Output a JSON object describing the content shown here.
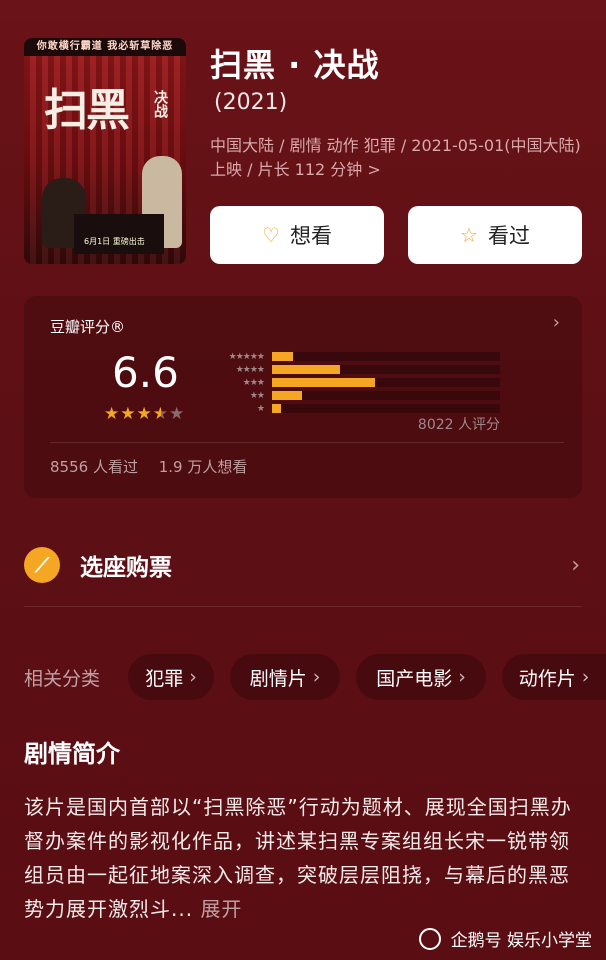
{
  "poster": {
    "top_strip": "你敢横行霸道 我必斩草除恶",
    "big_title": "扫黑",
    "small_title": "决战",
    "date_text": "6月1日 重磅出击"
  },
  "movie": {
    "title": "扫黑 · 决战",
    "year": "(2021)",
    "meta": "中国大陆 / 剧情 动作 犯罪 / 2021-05-01(中国大陆) 上映 / 片长 112 分钟 >"
  },
  "buttons": {
    "want": "想看",
    "seen": "看过"
  },
  "rating": {
    "label": "豆瓣评分®",
    "score": "6.6",
    "stars": [
      "★",
      "★",
      "★",
      "★",
      "★"
    ],
    "star_value": 3.5,
    "distribution": [
      {
        "stars": "★★★★★",
        "fraction": 0.09
      },
      {
        "stars": "★★★★",
        "fraction": 0.3
      },
      {
        "stars": "★★★",
        "fraction": 0.45
      },
      {
        "stars": "★★",
        "fraction": 0.13
      },
      {
        "stars": "★",
        "fraction": 0.04
      }
    ],
    "count": "8022 人评分",
    "watched": "8556 人看过",
    "want": "1.9 万人想看"
  },
  "ticket": {
    "label": "选座购票"
  },
  "tags": {
    "label": "相关分类",
    "items": [
      "犯罪",
      "剧情片",
      "国产电影",
      "动作片"
    ]
  },
  "synopsis": {
    "heading": "剧情简介",
    "text": "该片是国内首部以“扫黑除恶”行动为题材、展现全国扫黑办督办案件的影视化作品，讲述某扫黑专案组组长宋一锐带领组员由一起征地案深入调查，突破层层阻挠，与幕后的黑恶势力展开激烈斗...",
    "more": "展开"
  },
  "watermark": "企鹅号 娱乐小学堂",
  "colors": {
    "background": "#5e1015",
    "accent": "#f5a623"
  }
}
